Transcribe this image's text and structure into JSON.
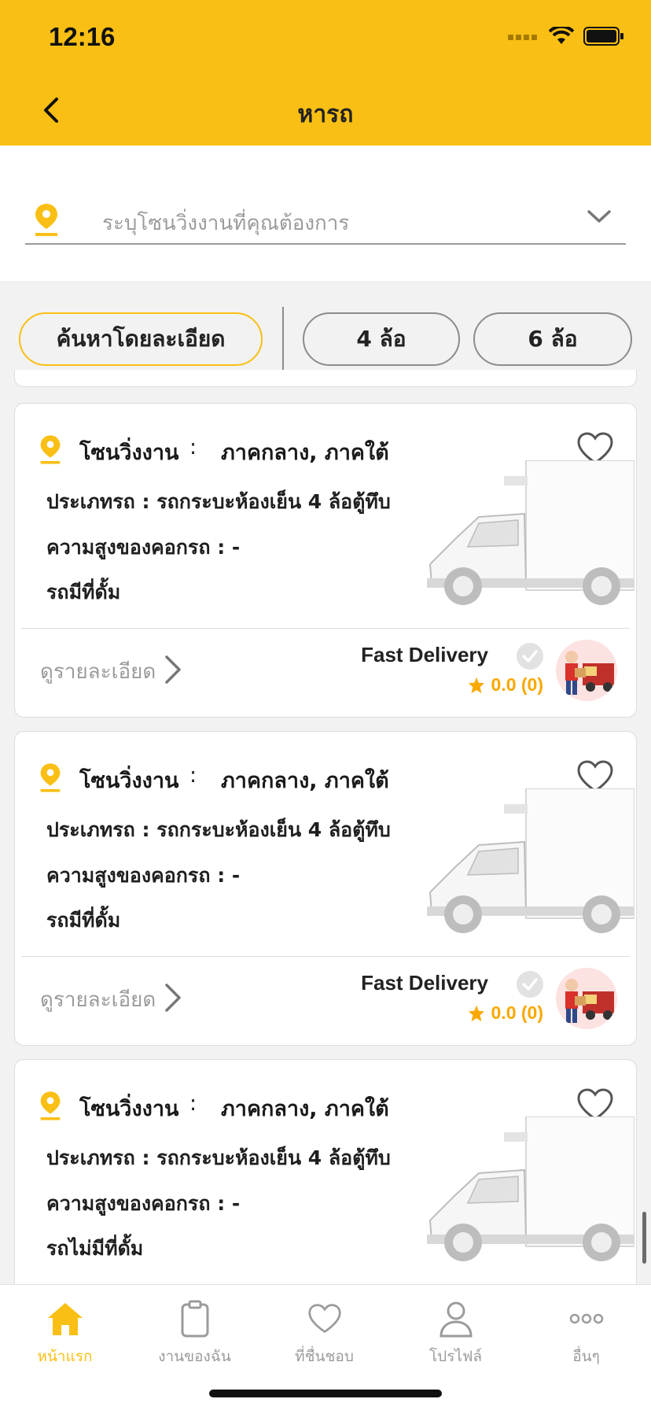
{
  "status": {
    "time": "12:16"
  },
  "header": {
    "title": "หารถ"
  },
  "zone_select": {
    "placeholder": "ระบุโซนวิ่งงานที่คุณต้องการ"
  },
  "filters": [
    {
      "label": "ค้นหาโดยละเอียด",
      "active": true
    },
    {
      "label": "4 ล้อ",
      "active": false
    },
    {
      "label": "6 ล้อ",
      "active": false
    }
  ],
  "cards": [
    {
      "zone_label": "โซนวิ่งงาน",
      "zone_colon": ":",
      "zone_value": "ภาคกลาง, ภาคใต้",
      "type_line": "ประเภทรถ : รถกระบะห้องเย็น 4 ล้อตู้ทึบ",
      "height_line": "ความสูงของคอกรถ : -",
      "ramp_line": "รถมีที่ดั้ม",
      "detail_label": "ดูรายละเอียด",
      "company": "Fast Delivery",
      "rating": "0.0 (0)"
    },
    {
      "zone_label": "โซนวิ่งงาน",
      "zone_colon": ":",
      "zone_value": "ภาคกลาง, ภาคใต้",
      "type_line": "ประเภทรถ : รถกระบะห้องเย็น 4 ล้อตู้ทึบ",
      "height_line": "ความสูงของคอกรถ : -",
      "ramp_line": "รถมีที่ดั้ม",
      "detail_label": "ดูรายละเอียด",
      "company": "Fast Delivery",
      "rating": "0.0 (0)"
    },
    {
      "zone_label": "โซนวิ่งงาน",
      "zone_colon": ":",
      "zone_value": "ภาคกลาง, ภาคใต้",
      "type_line": "ประเภทรถ : รถกระบะห้องเย็น 4 ล้อตู้ทึบ",
      "height_line": "ความสูงของคอกรถ : -",
      "ramp_line": "รถไม่มีที่ดั้ม"
    }
  ],
  "tabbar": [
    {
      "label": "หน้าแรก",
      "icon": "home-icon",
      "active": true
    },
    {
      "label": "งานของฉัน",
      "icon": "clipboard-icon",
      "active": false
    },
    {
      "label": "ที่ชื่นชอบ",
      "icon": "heart-icon",
      "active": false
    },
    {
      "label": "โปรไฟล์",
      "icon": "person-icon",
      "active": false
    },
    {
      "label": "อื่นๆ",
      "icon": "more-icon",
      "active": false
    }
  ],
  "colors": {
    "accent": "#f9bf14",
    "star": "#f9a800",
    "muted": "#9b9b9b"
  }
}
